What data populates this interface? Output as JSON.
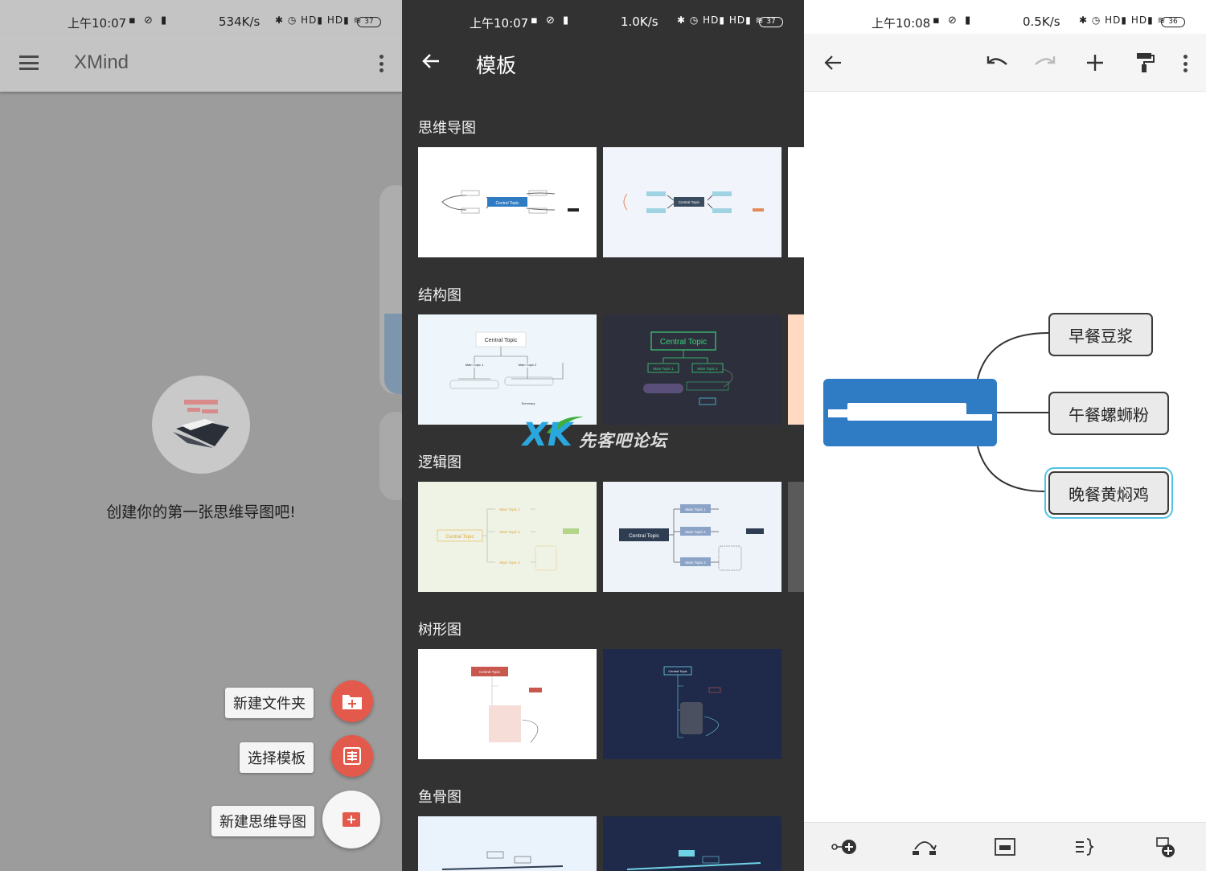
{
  "status_bars": [
    {
      "time": "上午10:07",
      "icons": "▪ ⊘ ▮",
      "speed": "534K/s",
      "right": "✱ ◷ HD▮ HD▮ ≋",
      "battery": "37"
    },
    {
      "time": "上午10:07",
      "icons": "▪ ⊘ ▮",
      "speed": "1.0K/s",
      "right": "✱ ◷ HD▮ HD▮ ≋",
      "battery": "37"
    },
    {
      "time": "上午10:08",
      "icons": "▪ ⊘ ▮",
      "speed": "0.5K/s",
      "right": "✱ ◷ HD▮ HD▮ ≋",
      "battery": "36"
    }
  ],
  "home": {
    "app_title": "XMind",
    "empty_text": "创建你的第一张思维导图吧!",
    "fab_new_folder": "新建文件夹",
    "fab_choose_template": "选择模板",
    "fab_new_mindmap": "新建思维导图"
  },
  "templates": {
    "title": "模板",
    "sections": [
      {
        "label": "思维导图"
      },
      {
        "label": "结构图"
      },
      {
        "label": "逻辑图"
      },
      {
        "label": "树形图"
      },
      {
        "label": "鱼骨图"
      }
    ],
    "thumb_text": {
      "central": "Central Topic",
      "main1": "Main Topic 1",
      "main2": "Main Topic 2",
      "main3": "Main Topic 3",
      "subtopic": "Subtopic",
      "summary": "Summary",
      "boundary": "Boundary"
    },
    "watermark_logo": "XK",
    "watermark_text": "先客吧论坛"
  },
  "editor": {
    "nodes": [
      {
        "label": "早餐豆浆"
      },
      {
        "label": "午餐螺蛳粉"
      },
      {
        "label": "晚餐黄焖鸡"
      }
    ],
    "colors": {
      "central": "#2f7bc4",
      "selection": "#4fc3e6",
      "fab": "#e35a4d"
    }
  },
  "icons": {
    "menu": "hamburger-icon",
    "more": "more-vert-icon",
    "back": "arrow-back-icon",
    "undo": "undo-icon",
    "redo": "redo-icon",
    "add": "plus-icon",
    "format": "format-paint-icon"
  }
}
